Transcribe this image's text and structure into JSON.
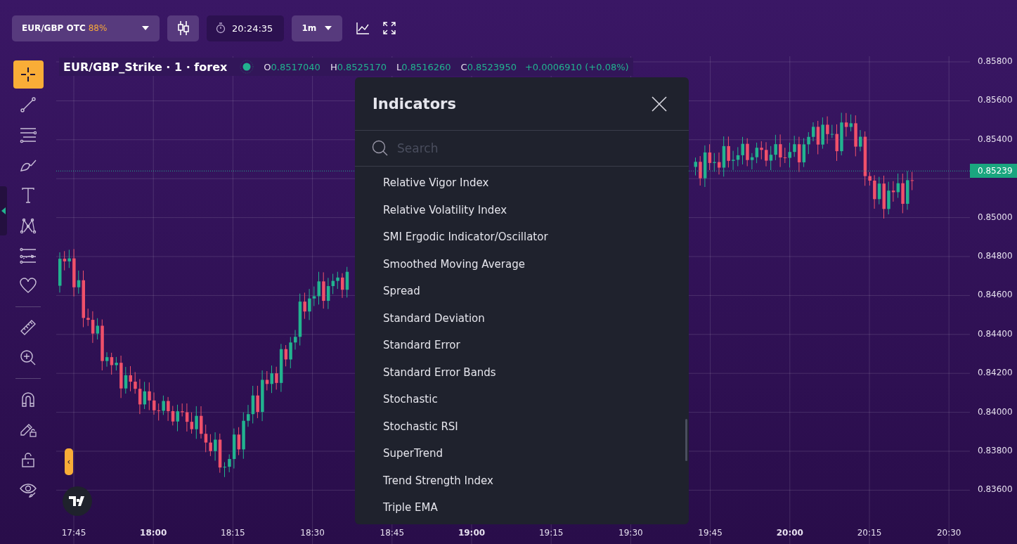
{
  "top_bar": {
    "asset": {
      "name": "EUR/GBP OTC",
      "payout": "88%"
    },
    "timer": "20:24:35",
    "timeframe": "1m"
  },
  "tools": [
    {
      "kind": "crosshair",
      "selected": true
    },
    {
      "kind": "trend-line",
      "selected": false
    },
    {
      "kind": "fib",
      "selected": false
    },
    {
      "kind": "brush",
      "selected": false
    },
    {
      "kind": "text",
      "selected": false
    },
    {
      "kind": "pattern",
      "selected": false
    },
    {
      "kind": "forecast",
      "selected": false
    },
    {
      "kind": "heart",
      "selected": false
    },
    {
      "kind": "divider"
    },
    {
      "kind": "ruler",
      "selected": false
    },
    {
      "kind": "zoom",
      "selected": false
    },
    {
      "kind": "divider"
    },
    {
      "kind": "magnet",
      "selected": false
    },
    {
      "kind": "draw-lock",
      "selected": false
    },
    {
      "kind": "lock",
      "selected": false
    },
    {
      "kind": "eye",
      "selected": false
    }
  ],
  "legend": {
    "title": "EUR/GBP_Strike · 1 · forex",
    "fields": [
      {
        "label": "O",
        "value": "0.8517040"
      },
      {
        "label": "H",
        "value": "0.8525170"
      },
      {
        "label": "L",
        "value": "0.8516260"
      },
      {
        "label": "C",
        "value": "0.8523950"
      }
    ],
    "change": "+0.0006910 (+0.08%)"
  },
  "price_axis": [
    "0.85800",
    "0.85600",
    "0.85400",
    "0.85000",
    "0.84800",
    "0.84600",
    "0.84400",
    "0.84200",
    "0.84000",
    "0.83800",
    "0.83600"
  ],
  "current_price": "0.85239",
  "time_axis": [
    {
      "label": "17:45",
      "major": false
    },
    {
      "label": "18:00",
      "major": true
    },
    {
      "label": "18:15",
      "major": false
    },
    {
      "label": "18:30",
      "major": false
    },
    {
      "label": "18:45",
      "major": false
    },
    {
      "label": "19:00",
      "major": true
    },
    {
      "label": "19:15",
      "major": false
    },
    {
      "label": "19:30",
      "major": false
    },
    {
      "label": "19:45",
      "major": false
    },
    {
      "label": "20:00",
      "major": true
    },
    {
      "label": "20:15",
      "major": false
    },
    {
      "label": "20:30",
      "major": false
    }
  ],
  "collapse_tab": "‹",
  "indicators_dialog": {
    "title": "Indicators",
    "search": {
      "placeholder": "Search"
    },
    "items": [
      "Relative Vigor Index",
      "Relative Volatility Index",
      "SMI Ergodic Indicator/Oscillator",
      "Smoothed Moving Average",
      "Spread",
      "Standard Deviation",
      "Standard Error",
      "Standard Error Bands",
      "Stochastic",
      "Stochastic RSI",
      "SuperTrend",
      "Trend Strength Index",
      "Triple EMA"
    ]
  }
}
